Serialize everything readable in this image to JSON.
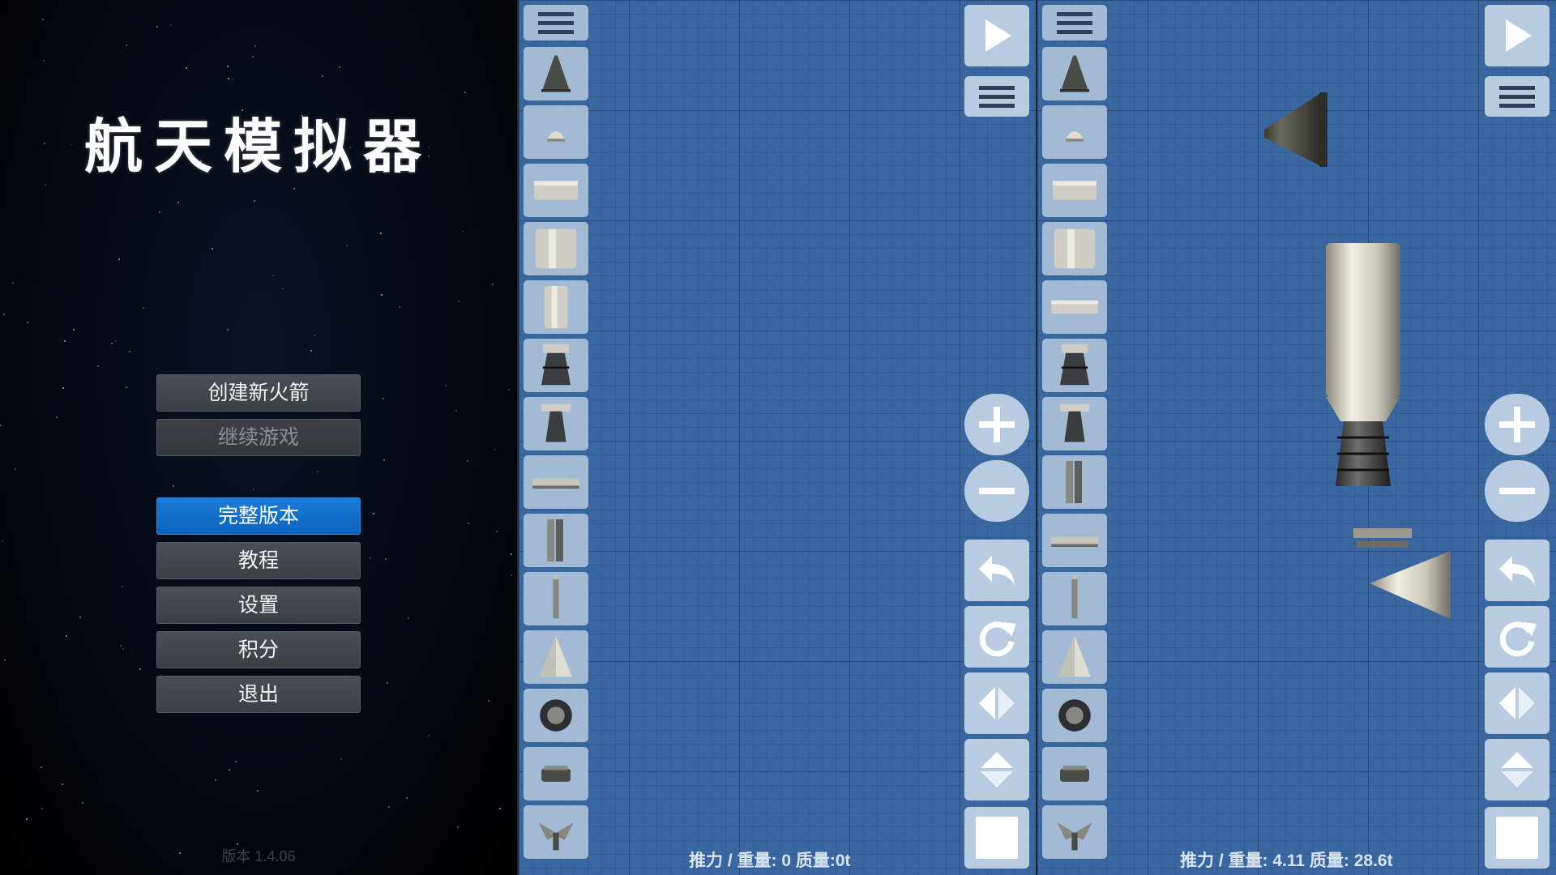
{
  "menu": {
    "title": "航天模拟器",
    "buttons": [
      {
        "label": "创建新火箭",
        "state": "normal"
      },
      {
        "label": "继续游戏",
        "state": "disabled"
      },
      {
        "label": "完整版本",
        "state": "primary"
      },
      {
        "label": "教程",
        "state": "normal"
      },
      {
        "label": "设置",
        "state": "normal"
      },
      {
        "label": "积分",
        "state": "normal"
      },
      {
        "label": "退出",
        "state": "normal"
      }
    ],
    "version": "版本 1.4.06"
  },
  "build_a": {
    "parts": [
      "capsule-icon",
      "probe-icon",
      "fuel-tank-small-icon",
      "fuel-tank-large-icon",
      "fuel-tank-tall-icon",
      "engine-large-icon",
      "engine-small-icon",
      "separator-icon",
      "side-separator-icon",
      "strut-icon",
      "nose-cone-icon",
      "wheel-icon",
      "docking-port-icon",
      "parachute-icon"
    ],
    "stats": "推力 / 重量: 0   质量:0t"
  },
  "build_b": {
    "parts": [
      "capsule-icon",
      "probe-icon",
      "fuel-tank-small-icon",
      "fuel-tank-large-icon",
      "fuel-tank-flat-icon",
      "engine-large-icon",
      "engine-small-icon",
      "side-separator-icon",
      "separator-icon",
      "strut-icon",
      "nose-cone-icon",
      "wheel-icon",
      "docking-port-icon",
      "parachute-icon"
    ],
    "stats": "推力 / 重量: 4.11   质量: 28.6t"
  },
  "colors": {
    "grid_bg": "#3b67a0",
    "primary_button": "#1a7bd9",
    "menu_button": "#3f434a"
  }
}
